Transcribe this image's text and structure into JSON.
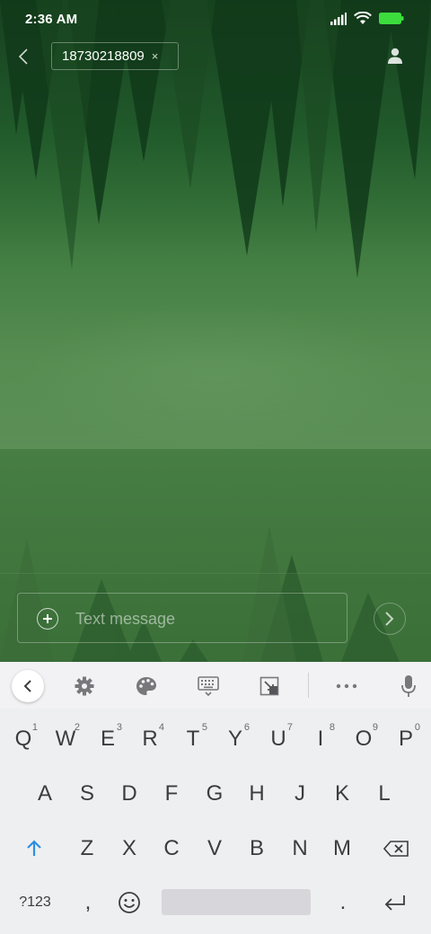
{
  "status_bar": {
    "time": "2:36 AM",
    "icons": [
      "signal-icon",
      "wifi-icon",
      "battery-icon"
    ],
    "battery_color": "#3ddc3d"
  },
  "header": {
    "back_icon": "chevron-left-icon",
    "recipient": "18730218809",
    "remove_recipient": "×",
    "contact_icon": "person-icon"
  },
  "compose": {
    "placeholder": "Text message",
    "value": "",
    "attach_icon": "plus-circle-icon",
    "send_icon": "chevron-right-icon"
  },
  "keyboard": {
    "toolbar": [
      "collapse-icon",
      "gear-icon",
      "palette-icon",
      "keyboard-icon",
      "resize-icon",
      "more-icon",
      "mic-icon"
    ],
    "row1": [
      {
        "label": "Q",
        "hint": "1"
      },
      {
        "label": "W",
        "hint": "2"
      },
      {
        "label": "E",
        "hint": "3"
      },
      {
        "label": "R",
        "hint": "4"
      },
      {
        "label": "T",
        "hint": "5"
      },
      {
        "label": "Y",
        "hint": "6"
      },
      {
        "label": "U",
        "hint": "7"
      },
      {
        "label": "I",
        "hint": "8"
      },
      {
        "label": "O",
        "hint": "9"
      },
      {
        "label": "P",
        "hint": "0"
      }
    ],
    "row2": [
      "A",
      "S",
      "D",
      "F",
      "G",
      "H",
      "J",
      "K",
      "L"
    ],
    "row3": [
      "Z",
      "X",
      "C",
      "V",
      "B",
      "N",
      "M"
    ],
    "row4": {
      "symbols": "?123",
      "comma": ",",
      "period": "."
    },
    "accent_color": "#2e8fe0"
  }
}
